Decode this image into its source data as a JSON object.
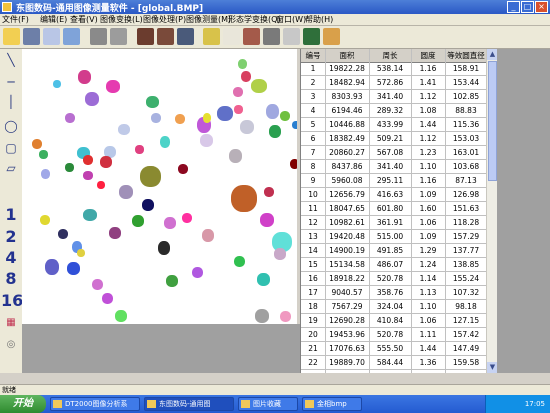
{
  "window": {
    "title": "东图数码-通用图像测量软件 - [global.BMP]"
  },
  "menu": [
    "文件(F)",
    "编辑(E)",
    "查看(V)",
    "图像变换(L)",
    "图像处理(P)",
    "图像测量(M)",
    "形态学变换(Q)",
    "窗口(W)",
    "帮助(H)"
  ],
  "left_tools": {
    "numbers": [
      "1",
      "2",
      "4",
      "8",
      "16"
    ]
  },
  "table": {
    "headers": [
      "编号",
      "面积",
      "周长",
      "圆度",
      "等效圆直径"
    ],
    "rows": [
      [
        "1",
        "19822.28",
        "538.14",
        "1.16",
        "158.91"
      ],
      [
        "2",
        "18482.94",
        "572.86",
        "1.41",
        "153.44"
      ],
      [
        "3",
        "8303.93",
        "341.40",
        "1.12",
        "102.85"
      ],
      [
        "4",
        "6194.46",
        "289.32",
        "1.08",
        "88.83"
      ],
      [
        "5",
        "10446.88",
        "433.99",
        "1.44",
        "115.36"
      ],
      [
        "6",
        "18382.49",
        "509.21",
        "1.12",
        "153.03"
      ],
      [
        "7",
        "20860.27",
        "567.08",
        "1.23",
        "163.01"
      ],
      [
        "8",
        "8437.86",
        "341.40",
        "1.10",
        "103.68"
      ],
      [
        "9",
        "5960.08",
        "295.11",
        "1.16",
        "87.13"
      ],
      [
        "10",
        "12656.79",
        "416.63",
        "1.09",
        "126.98"
      ],
      [
        "11",
        "18047.65",
        "601.80",
        "1.60",
        "151.63"
      ],
      [
        "12",
        "10982.61",
        "361.91",
        "1.06",
        "118.28"
      ],
      [
        "13",
        "19420.48",
        "515.00",
        "1.09",
        "157.29"
      ],
      [
        "14",
        "14900.19",
        "491.85",
        "1.29",
        "137.77"
      ],
      [
        "15",
        "15134.58",
        "486.07",
        "1.24",
        "138.85"
      ],
      [
        "16",
        "18918.22",
        "520.78",
        "1.14",
        "155.24"
      ],
      [
        "17",
        "9040.57",
        "358.76",
        "1.13",
        "107.32"
      ],
      [
        "18",
        "7567.29",
        "324.04",
        "1.10",
        "98.18"
      ],
      [
        "19",
        "12690.28",
        "410.84",
        "1.06",
        "127.15"
      ],
      [
        "20",
        "19453.96",
        "520.78",
        "1.11",
        "157.42"
      ],
      [
        "21",
        "17076.63",
        "555.50",
        "1.44",
        "147.49"
      ],
      [
        "22",
        "19889.70",
        "584.44",
        "1.36",
        "159.58"
      ]
    ]
  },
  "status": {
    "text": "就绪"
  },
  "taskbar": {
    "start_label": "开始",
    "tasks": [
      "DT2000图像分析系",
      "东图数码-通用图",
      "图片收藏",
      "金相bmp"
    ],
    "clock": "17:05"
  }
}
